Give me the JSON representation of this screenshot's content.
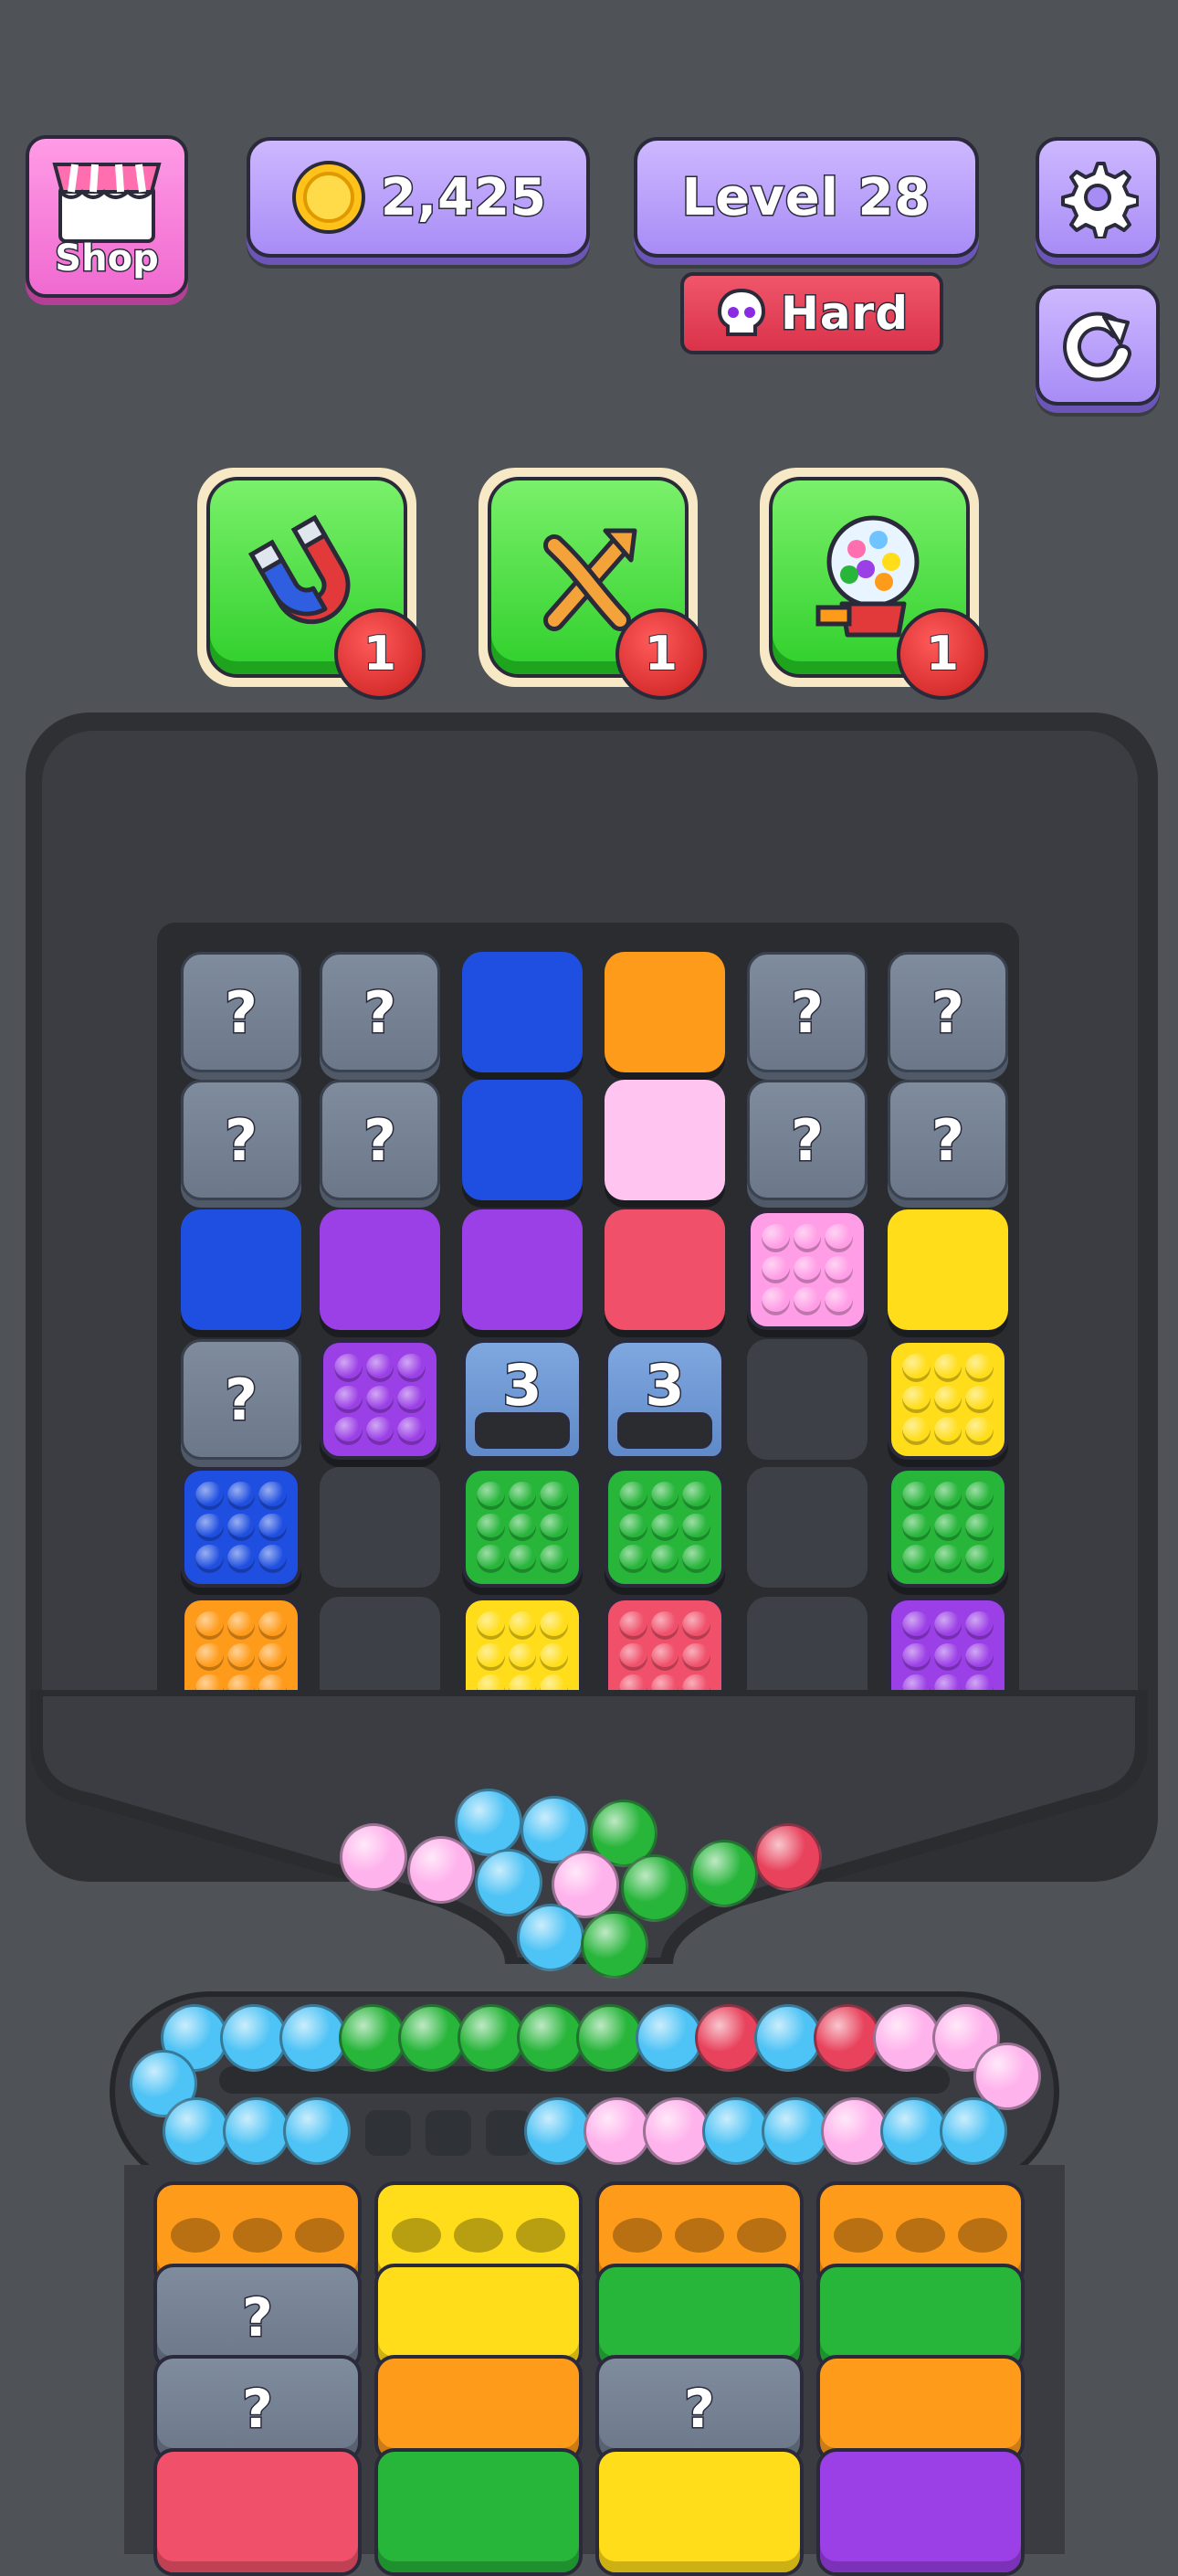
{
  "hud": {
    "shop_label": "Shop",
    "coins": "2,425",
    "level": "Level 28",
    "difficulty": "Hard"
  },
  "boosters": [
    {
      "icon": "magnet-icon",
      "count": "1"
    },
    {
      "icon": "shuffle-icon",
      "count": "1"
    },
    {
      "icon": "gumball-machine-icon",
      "count": "1"
    }
  ],
  "board": {
    "mystery_mark": "?",
    "tunnel_counts": [
      "3",
      "3"
    ],
    "colors": {
      "blue": "#1f4fe0",
      "orange": "#ff9b1a",
      "light_pink": "#ffc4f0",
      "purple": "#9b3fe6",
      "red": "#f0506a",
      "pink": "#ff9ee6",
      "yellow": "#ffdd1a",
      "green": "#27b53a"
    }
  },
  "stacks": {
    "mystery_mark": "?"
  }
}
